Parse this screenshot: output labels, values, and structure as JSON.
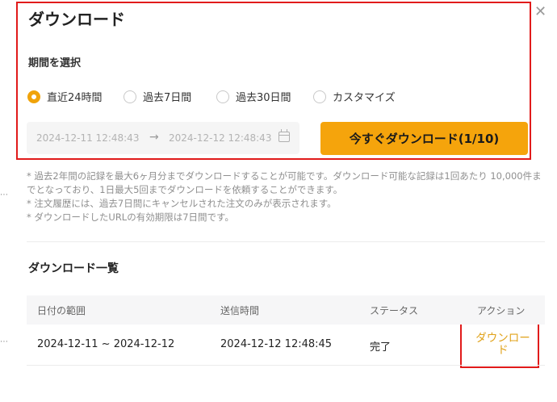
{
  "dialog": {
    "title": "ダウンロード",
    "close_icon": "close-icon",
    "period_label": "期間を選択",
    "periods": [
      {
        "label": "直近24時間",
        "selected": true
      },
      {
        "label": "過去7日間",
        "selected": false
      },
      {
        "label": "過去30日間",
        "selected": false
      },
      {
        "label": "カスタマイズ",
        "selected": false
      }
    ],
    "date_range": {
      "start": "2024-12-11 12:48:43",
      "separator": "→",
      "end": "2024-12-12 12:48:43",
      "icon": "calendar-icon"
    },
    "download_now_label": "今すぐダウンロード(1/10)",
    "notes": [
      "* 過去2年間の記録を最大6ヶ月分までダウンロードすることが可能です。ダウンロード可能な記録は1回あたり 10,000件までとなっており、1日最大5回までダウンロードを依頼することができます。",
      "* 注文履歴には、過去7日間にキャンセルされた注文のみが表示されます。",
      "* ダウンロードしたURLの有効期限は7日間です。"
    ],
    "list_title": "ダウンロード一覧",
    "table": {
      "headers": [
        "日付の範囲",
        "送信時間",
        "ステータス",
        "アクション"
      ],
      "rows": [
        {
          "range": "2024-12-11 ~ 2024-12-12",
          "sent": "2024-12-12 12:48:45",
          "status": "完了",
          "action": "ダウンロード"
        }
      ]
    }
  },
  "colors": {
    "accent": "#f5a40c",
    "action_link": "#e0a21a",
    "highlight": "#e11b1b"
  }
}
